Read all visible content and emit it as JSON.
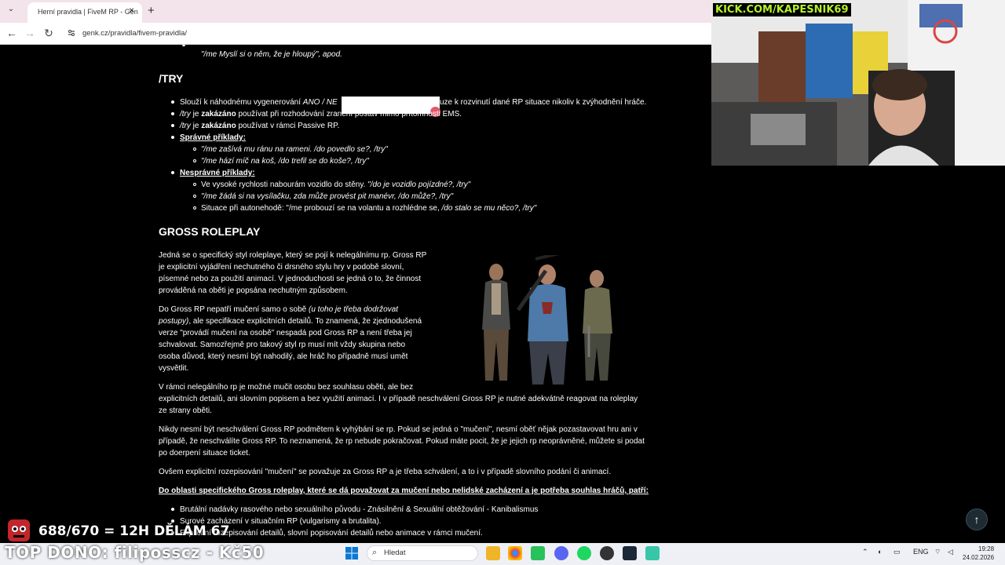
{
  "browser": {
    "tab_title": "Herní pravidla | FiveM RP - Gen",
    "tab_close": "×",
    "new_tab": "+",
    "tab_list": "⌄",
    "back": "←",
    "forward": "→",
    "reload": "↻",
    "url": "genk.cz/pravidla/fivem-pravidla/"
  },
  "page": {
    "top_line": "\"/me Myslí si o něm, že je hloupý\", apod.",
    "try_heading": "/TRY",
    "try_items": [
      {
        "pre": "Slouží k náhodnému vygenerování ",
        "it": "ANO / NE",
        "post": "uze k rozvinutí dané RP situace nikoliv k zvýhodnění hráče."
      },
      {
        "it": "/try",
        "pre": " je ",
        "bold": "zakázáno",
        "post": " používat při rozhodování zranění postav mimo přítomnosti EMS."
      },
      {
        "it": "/try",
        "pre": " je ",
        "bold": "zakázáno",
        "post": " používat v rámci Passive RP."
      }
    ],
    "correct_label": "Správné příklady:",
    "correct_examples": [
      "\"/me zašívá mu ránu na rameni. /do povedlo se?, /try\"",
      "\"/me hází míč na koš, /do trefil se do koše?, /try\""
    ],
    "wrong_label": "Nesprávné příklady:",
    "wrong_examples": [
      {
        "pre": "Ve vysoké rychlosti nabourám vozidlo do stěny. ",
        "it": "\"/do je vozidlo pojízdné?, /try\""
      },
      {
        "pre": "",
        "it": "\"/me žádá si na vysílačku, zda může provést pit manévr, /do může?, /try\""
      },
      {
        "pre": "Situace při autonehodě: \"/me probouzí se na volantu a rozhlédne se, ",
        "it": "/do stalo se mu něco?, /try\""
      }
    ],
    "gross_heading": "GROSS ROLEPLAY",
    "gross_p1": [
      "Jedná se o specifický styl roleplaye, který se pojí k nelegálnímu rp. Gross RP",
      "je explicitní vyjádření nechutného či drsného stylu hry v podobě slovní,",
      "písemné nebo za použití animací. V jednoduchosti se jedná o to, že činnost",
      "prováděná na oběti je popsána nechutným způsobem."
    ],
    "gross_p2_a": "Do Gross RP nepatří mučení samo o sobě ",
    "gross_p2_it": "(u toho je třeba dodržovat",
    "gross_p2_it2": "postupy)",
    "gross_p2_b": ", ale specifikace explicitních detailů. To znamená, že zjednodušená",
    "gross_p2_lines": [
      "verze \"provádí mučení na osobě\" nespadá pod Gross RP a není třeba jej",
      "schvalovat. Samozřejmě pro takový styl rp musí mít vždy skupina nebo",
      "osoba důvod, který nesmí být nahodilý, ale hráč ho případně musí umět",
      "vysvětlit."
    ],
    "gross_p3": [
      "V rámci nelegálního rp je možné mučit osobu bez souhlasu oběti, ale bez",
      "explicitních detailů, ani slovním popisem a bez využití animací. I v případě neschválení Gross RP je nutné adekvátně reagovat na roleplay",
      "ze strany oběti."
    ],
    "gross_p4": [
      "Nikdy nesmí být neschválení Gross RP podmětem k vyhýbání se rp. Pokud se jedná o \"mučení\", nesmí oběť nějak pozastavovat hru ani v",
      "případě, že neschválíte Gross RP. To neznamená, že rp nebude pokračovat. Pokud máte pocit, že je jejich rp neoprávněné, můžete si podat",
      "po doerpení situace ticket."
    ],
    "gross_p5": "Ovšem explicitní rozepisování \"mučení\" se považuje za Gross RP a je třeba schválení, a to i v případě slovního podání či animací.",
    "gross_p6": "Do oblasti specifického Gross roleplay, které se dá považovat za mučení nebo nelidské zacházení a je potřeba souhlas hráčů, patří:",
    "gross_list": [
      "Brutální nadávky rasového nebo sexuálního původu - Znásilnění & Sexuální obtěžování - Kanibalismus",
      "Surové zacházení v situačním RP (vulgarismy a brutalita).",
      "Explicitní rozepisování detailů, slovní popisování detailů nebo animace v rámci mučení."
    ]
  },
  "overlay": {
    "kick": "KICK.COM/KAPESNIK69",
    "donation_count": "688/670 = 12H DĚLÁM 67",
    "top_dono": "TOP DONO: filiposscz - Kč50",
    "scroll_top": "↑"
  },
  "taskbar": {
    "search_placeholder": "Hledat",
    "lang": "ENG",
    "time": "19:28",
    "date": "24.02.2026"
  }
}
